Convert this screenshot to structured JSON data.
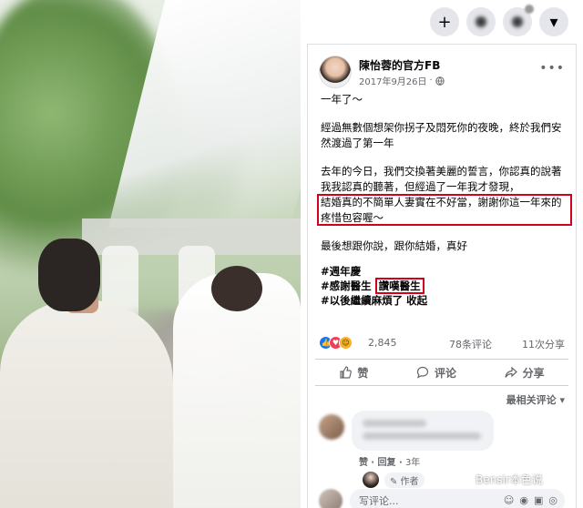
{
  "topbar": {
    "icons": [
      "plus-icon",
      "messenger-icon",
      "notification-icon",
      "chevron-down-icon"
    ],
    "plus_label": "+",
    "chevron_label": "▾"
  },
  "post": {
    "author": "陳怡蓉的官方FB",
    "date": "2017年9月26日",
    "privacy_icon": "globe-icon",
    "more_label": "•••",
    "paragraphs": [
      "一年了～",
      "經過無數個想架你拐子及悶死你的夜晚，終於我們安然渡過了第一年",
      "去年的今日，我們交換著美麗的誓言，你認真的說著我我認真的聽著，但經過了一年我才發現，"
    ],
    "highlight_text": "結婚真的不簡單人妻實在不好當，謝謝你這一年來的疼惜包容喔～",
    "closing": "最後想跟你說，跟你結婚，真好",
    "tags": {
      "line1": "#週年慶",
      "line2_prefix": "#感謝醫生 ",
      "line2_highlight": "讚嘆醫生",
      "line3": "#以後繼續麻煩了 收起"
    }
  },
  "stats": {
    "reaction_count": "2,845",
    "comments": "78条评论",
    "shares": "11次分享"
  },
  "actions": {
    "like": "赞",
    "comment": "评论",
    "share": "分享"
  },
  "comments": {
    "sort_label": "最相关评论 ▾",
    "meta_like": "赞",
    "meta_reply": "· 回复 ·",
    "meta_time": "3年",
    "author_badge": "✎ 作者",
    "compose_placeholder": "写评论..."
  },
  "watermark": "Bensir本色说",
  "colors": {
    "highlight": "#d0021b",
    "facebook_blue": "#1877f2"
  }
}
